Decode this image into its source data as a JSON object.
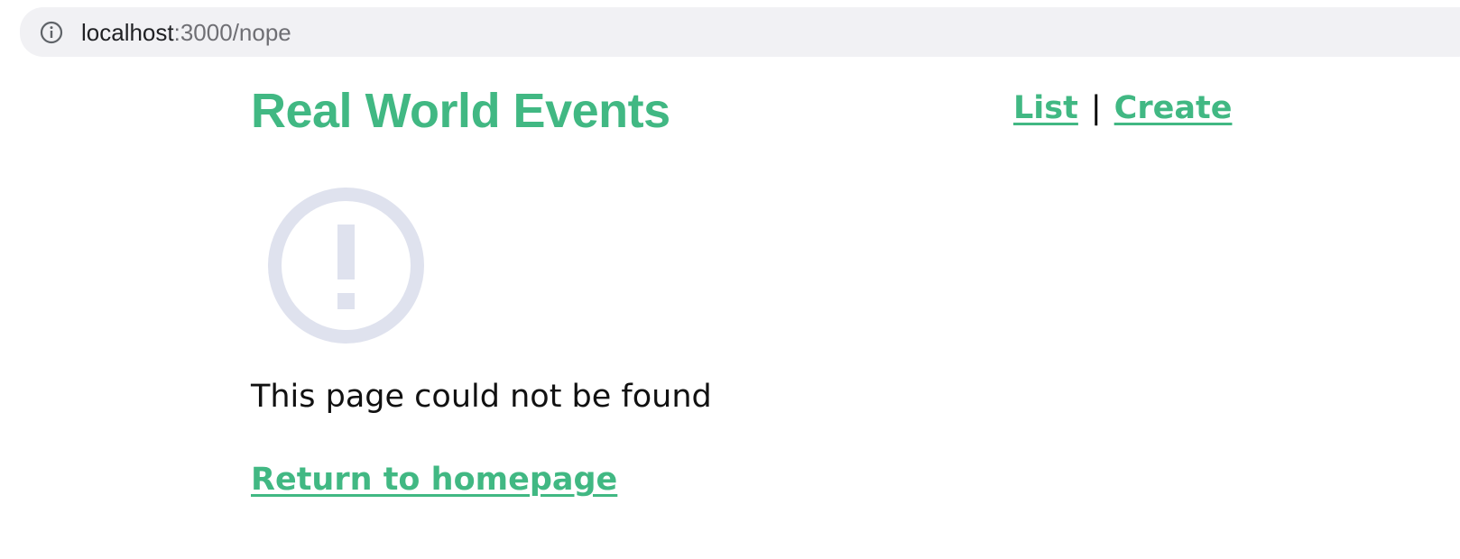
{
  "browser": {
    "url_host": "localhost",
    "url_rest": ":3000/nope",
    "icon": "info-icon"
  },
  "header": {
    "brand": "Real World Events",
    "nav": {
      "list_label": "List",
      "separator": "|",
      "create_label": "Create"
    }
  },
  "main": {
    "icon": "exclamation-circle-icon",
    "icon_color": "#dfe2ee",
    "message": "This page could not be found",
    "home_link": "Return to homepage"
  },
  "colors": {
    "accent": "#41b883",
    "address_bar": "#f1f1f4"
  }
}
